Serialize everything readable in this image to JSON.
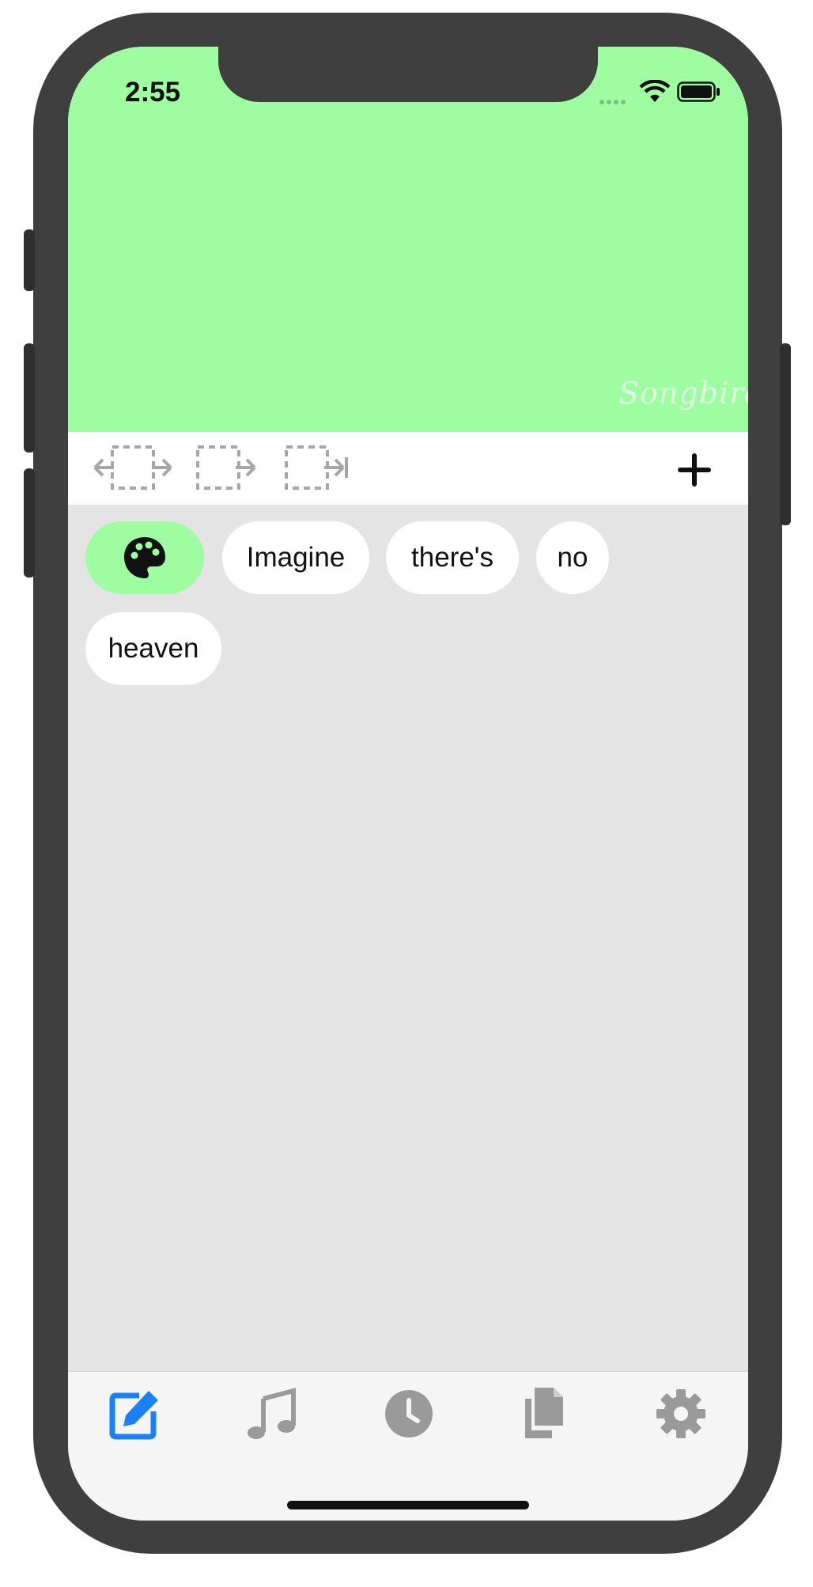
{
  "status_bar": {
    "time": "2:55"
  },
  "canvas": {
    "background": "#9efda0",
    "logo": "Songbird"
  },
  "toolbar": {
    "tools": [
      "move-both-icon",
      "move-right-icon",
      "move-to-end-icon"
    ],
    "add_icon": "plus-icon"
  },
  "words": [
    "Imagine",
    "there's",
    "no",
    "heaven"
  ],
  "palette_chip": {
    "icon": "palette-icon",
    "color": "#9efda0"
  },
  "tabbar": {
    "active_color": "#1a82f7",
    "inactive_color": "#9a9a9a",
    "tabs": [
      "edit-icon",
      "music-icon",
      "history-icon",
      "documents-icon",
      "settings-icon"
    ]
  }
}
